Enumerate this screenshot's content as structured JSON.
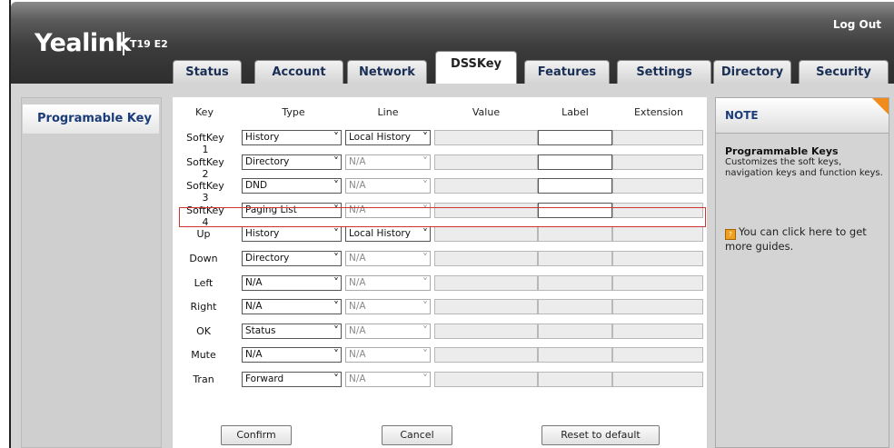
{
  "header": {
    "logo": "Yealink",
    "model": "T19 E2",
    "logout_label": "Log Out"
  },
  "tabs": [
    {
      "label": "Status",
      "active": false
    },
    {
      "label": "Account",
      "active": false
    },
    {
      "label": "Network",
      "active": false
    },
    {
      "label": "DSSKey",
      "active": true
    },
    {
      "label": "Features",
      "active": false
    },
    {
      "label": "Settings",
      "active": false
    },
    {
      "label": "Directory",
      "active": false
    },
    {
      "label": "Security",
      "active": false
    }
  ],
  "sidebar": {
    "items": [
      {
        "label": "Programable Key",
        "active": true
      }
    ]
  },
  "table": {
    "columns": [
      "Key",
      "Type",
      "Line",
      "Value",
      "Label",
      "Extension"
    ],
    "rows": [
      {
        "key": "SoftKey 1",
        "type": "History",
        "line": "Local History",
        "line_enabled": true,
        "label_enabled": true
      },
      {
        "key": "SoftKey 2",
        "type": "Directory",
        "line": "N/A",
        "line_enabled": false,
        "label_enabled": true
      },
      {
        "key": "SoftKey 3",
        "type": "DND",
        "line": "N/A",
        "line_enabled": false,
        "label_enabled": true
      },
      {
        "key": "SoftKey 4",
        "type": "Paging List",
        "line": "N/A",
        "line_enabled": false,
        "label_enabled": true,
        "highlighted": true
      },
      {
        "key": "Up",
        "type": "History",
        "line": "Local History",
        "line_enabled": true,
        "label_enabled": false
      },
      {
        "key": "Down",
        "type": "Directory",
        "line": "N/A",
        "line_enabled": false,
        "label_enabled": false
      },
      {
        "key": "Left",
        "type": "N/A",
        "line": "N/A",
        "line_enabled": false,
        "label_enabled": false
      },
      {
        "key": "Right",
        "type": "N/A",
        "line": "N/A",
        "line_enabled": false,
        "label_enabled": false
      },
      {
        "key": "OK",
        "type": "Status",
        "line": "N/A",
        "line_enabled": false,
        "label_enabled": false
      },
      {
        "key": "Mute",
        "type": "N/A",
        "line": "N/A",
        "line_enabled": false,
        "label_enabled": false
      },
      {
        "key": "Tran",
        "type": "Forward",
        "line": "N/A",
        "line_enabled": false,
        "label_enabled": false
      }
    ]
  },
  "buttons": {
    "confirm": "Confirm",
    "cancel": "Cancel",
    "reset": "Reset to default"
  },
  "note": {
    "title": "NOTE",
    "heading": "Programmable Keys",
    "text": "Customizes the soft keys, navigation keys and function keys.",
    "guide": "You can click here to get more guides."
  },
  "colors": {
    "highlight_border": "#d13333",
    "note_corner": "#f08c1c",
    "nav_text": "#1a3d7a"
  }
}
